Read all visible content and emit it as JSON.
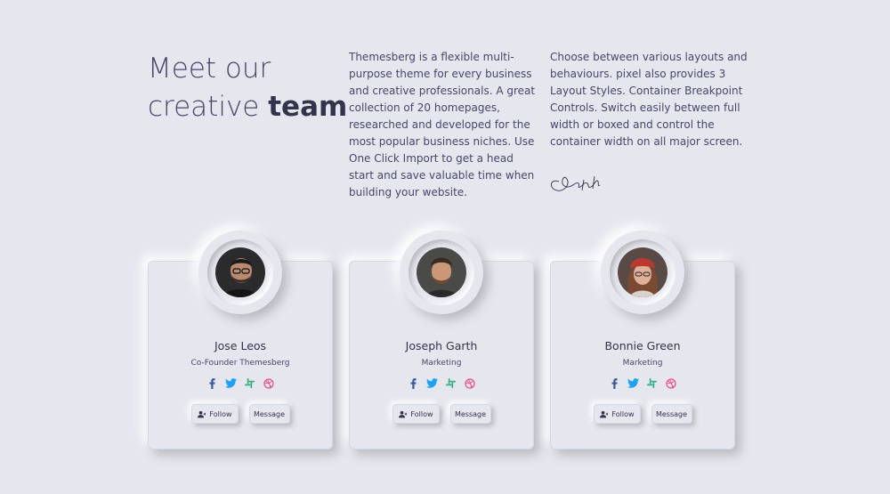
{
  "heading": {
    "line1": "Meet our",
    "line2_prefix": "creative ",
    "line2_bold": "team"
  },
  "intro": {
    "paragraph1": "Themesberg is a flexible multi-purpose theme for every business and creative professionals. A great collection of 20 homepages, researched and developed for the most popular business niches. Use One Click Import to get a head start and save valuable time when building your website.",
    "paragraph2": "Choose between various layouts and behaviours. pixel also provides 3 Layout Styles. Container Breakpoint Controls. Switch easily between full width or boxed and control the container width on all major screen."
  },
  "team": [
    {
      "name": "Jose Leos",
      "role": "Co-Founder Themesberg",
      "follow_label": "Follow",
      "message_label": "Message"
    },
    {
      "name": "Joseph Garth",
      "role": "Marketing",
      "follow_label": "Follow",
      "message_label": "Message"
    },
    {
      "name": "Bonnie Green",
      "role": "Marketing",
      "follow_label": "Follow",
      "message_label": "Message"
    }
  ],
  "social_icons": [
    "facebook-icon",
    "twitter-icon",
    "slack-icon",
    "dribbble-icon"
  ],
  "colors": {
    "background": "#e6e7ee",
    "text_dark": "#31344b",
    "facebook": "#3b5999",
    "twitter": "#1da1f2",
    "slack": "#3aaf85",
    "dribbble": "#ea4c89"
  }
}
